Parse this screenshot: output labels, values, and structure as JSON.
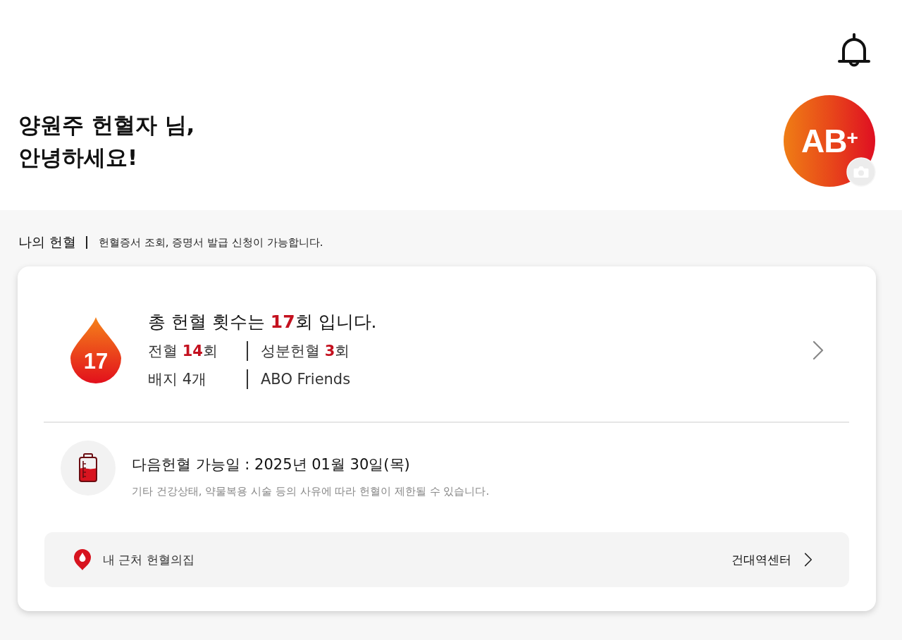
{
  "header": {
    "greeting": "양원주 헌혈자 님,\n안녕하세요!",
    "blood_type": "AB$^{+}$"
  },
  "section": {
    "title": "나의 헌혈",
    "description": "헌혈증서 조회, 증명서 발급 신청이 가능합니다."
  },
  "summary": {
    "drop_count": "17",
    "headline": "총 헌혈 횟수는 **17**회 입니다.",
    "stats": [
      [
        "전혈 **14**회",
        "성분헌혈 **3**회"
      ],
      [
        "배지 4개",
        "ABO Friends"
      ]
    ]
  },
  "next_donation": {
    "date": "다음헌혈 가능일 : 2025년 01월 30일(목)",
    "note": "기타 건강상태, 약물복용 시술 등의 사유에 따라 헌혈이 제한될 수 있습니다."
  },
  "nearby": {
    "label": "내 근처 헌혈의집",
    "center": "건대역센터"
  }
}
